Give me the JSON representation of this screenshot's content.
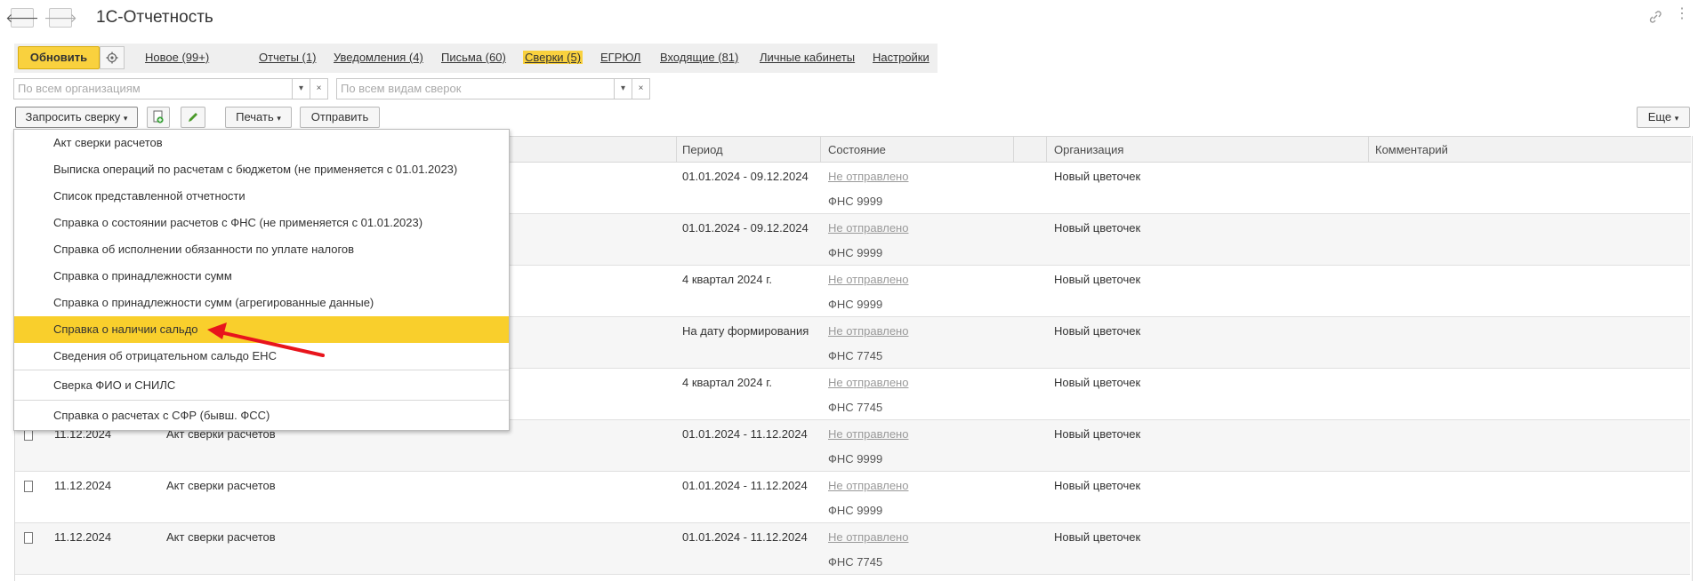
{
  "window": {
    "title": "1С-Отчетность"
  },
  "nav": {
    "back": "🡐",
    "forward": "🡒"
  },
  "toolbar_top": {
    "update_label": "Обновить"
  },
  "tabs": [
    {
      "label": "Новое (99+)",
      "active": false
    },
    {
      "label": "Отчеты (1)",
      "active": false
    },
    {
      "label": "Уведомления (4)",
      "active": false
    },
    {
      "label": "Письма (60)",
      "active": false
    },
    {
      "label": "Сверки (5)",
      "active": true
    },
    {
      "label": "ЕГРЮЛ",
      "active": false
    },
    {
      "label": "Входящие (81)",
      "active": false
    },
    {
      "label": "Личные кабинеты",
      "active": false
    },
    {
      "label": "Настройки",
      "active": false
    }
  ],
  "filters": {
    "org_placeholder": "По всем организациям",
    "type_placeholder": "По всем видам сверок",
    "dropdown_glyph": "▾",
    "clear_glyph": "×"
  },
  "actions": {
    "request_label": "Запросить сверку",
    "print_label": "Печать",
    "send_label": "Отправить",
    "more_label": "Еще"
  },
  "table": {
    "columns": [
      "Период",
      "Состояние",
      "Организация",
      "Комментарий"
    ],
    "rows": [
      {
        "date": "",
        "doc": "",
        "period": "01.01.2024 - 09.12.2024",
        "status": "Не отправлено",
        "authority": "ФНС 9999",
        "org": "Новый цветочек"
      },
      {
        "date": "",
        "doc": "",
        "period": "01.01.2024 - 09.12.2024",
        "status": "Не отправлено",
        "authority": "ФНС 9999",
        "org": "Новый цветочек"
      },
      {
        "date": "",
        "doc": "",
        "period": "4 квартал 2024 г.",
        "status": "Не отправлено",
        "authority": "ФНС 9999",
        "org": "Новый цветочек"
      },
      {
        "date": "",
        "doc": "",
        "period": "На дату формирования",
        "status": "Не отправлено",
        "authority": "ФНС 7745",
        "org": "Новый цветочек"
      },
      {
        "date": "",
        "doc": "",
        "period": "4 квартал 2024 г.",
        "status": "Не отправлено",
        "authority": "ФНС 7745",
        "org": "Новый цветочек"
      },
      {
        "date": "11.12.2024",
        "doc": "Акт сверки расчетов",
        "period": "01.01.2024 - 11.12.2024",
        "status": "Не отправлено",
        "authority": "ФНС 9999",
        "org": "Новый цветочек"
      },
      {
        "date": "11.12.2024",
        "doc": "Акт сверки расчетов",
        "period": "01.01.2024 - 11.12.2024",
        "status": "Не отправлено",
        "authority": "ФНС 9999",
        "org": "Новый цветочек"
      },
      {
        "date": "11.12.2024",
        "doc": "Акт сверки расчетов",
        "period": "01.01.2024 - 11.12.2024",
        "status": "Не отправлено",
        "authority": "ФНС 7745",
        "org": "Новый цветочек"
      }
    ]
  },
  "menu": {
    "items": [
      {
        "label": "Акт сверки расчетов"
      },
      {
        "label": "Выписка операций по расчетам с бюджетом (не применяется с 01.01.2023)"
      },
      {
        "label": "Список представленной отчетности"
      },
      {
        "label": "Справка о состоянии расчетов с ФНС (не применяется с 01.01.2023)"
      },
      {
        "label": "Справка об исполнении обязанности по уплате налогов"
      },
      {
        "label": "Справка о принадлежности сумм"
      },
      {
        "label": "Справка о принадлежности сумм (агрегированные данные)"
      },
      {
        "label": "Справка о наличии сальдо",
        "selected": true
      },
      {
        "label": "Сведения об отрицательном сальдо ЕНС"
      },
      {
        "label": "Сверка ФИО и СНИЛС"
      },
      {
        "label": "Справка о расчетах с СФР (бывш. ФСС)"
      }
    ]
  },
  "colors": {
    "accent": "#f9d13e",
    "annotation_arrow": "#e8141c"
  }
}
